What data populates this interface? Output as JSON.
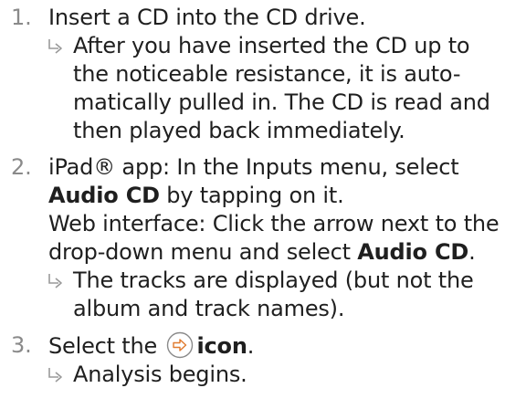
{
  "steps": [
    {
      "number": "1.",
      "instruction": "Insert a CD into the CD drive.",
      "result": "After you have inserted the CD up to the noticeable resistance, it is automatically pulled in. The CD is read and then played back immediately.",
      "result_lines": [
        "After you have inserted the CD up to",
        "the noticeable resistance, it is auto-",
        "matically pulled in. The CD is read and",
        "then played back immediately."
      ]
    },
    {
      "number": "2.",
      "line1": "iPad® app: In the Inputs menu, select",
      "bold1": "Audio CD",
      "after_bold1": " by tapping on it.",
      "line3": "Web interface: Click the arrow next to the",
      "line4_pre": "drop-down menu and select ",
      "bold2": "Audio CD",
      "line4_post": ".",
      "result_lines": [
        "The tracks are displayed (but not the",
        "album and track names)."
      ]
    },
    {
      "number": "3.",
      "pre": "Select the ",
      "icon": "forward-arrow-circle-icon",
      "bold": "icon",
      "post": ".",
      "result_lines": [
        "Analysis begins."
      ]
    }
  ],
  "colors": {
    "text": "#1f1f1f",
    "step_number": "#8a8a8a",
    "accent": "#e07a2e"
  }
}
